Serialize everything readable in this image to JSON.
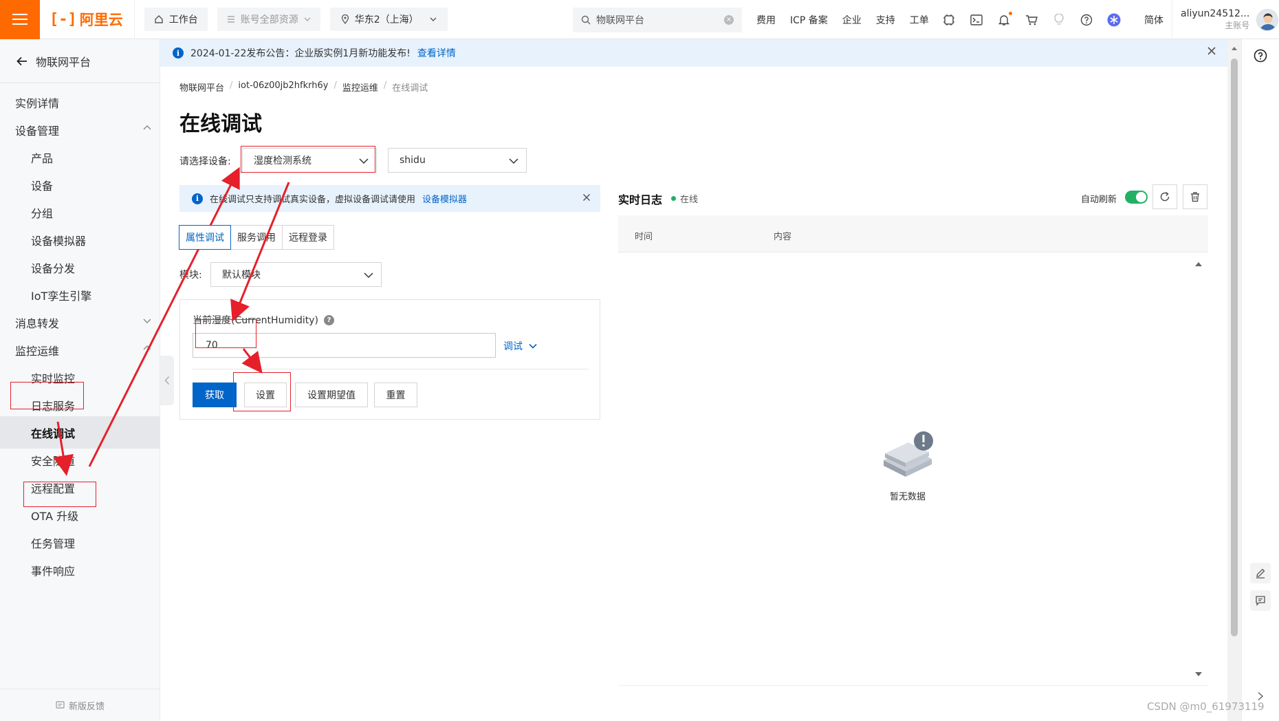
{
  "topbar": {
    "logo_text": "阿里云",
    "workbench": "工作台",
    "account_scope": "账号全部资源",
    "region": "华东2（上海）",
    "search_value": "物联网平台",
    "links": [
      "费用",
      "ICP 备案",
      "企业",
      "支持",
      "工单"
    ],
    "language": "简体",
    "account_name": "aliyun24512...",
    "account_role": "主账号"
  },
  "announcement": {
    "text": "2024-01-22发布公告：企业版实例1月新功能发布!",
    "link": "查看详情"
  },
  "sidebar": {
    "back_label": "物联网平台",
    "items": [
      {
        "label": "实例详情"
      },
      {
        "label": "设备管理"
      },
      {
        "label": "产品"
      },
      {
        "label": "设备"
      },
      {
        "label": "分组"
      },
      {
        "label": "设备模拟器"
      },
      {
        "label": "设备分发"
      },
      {
        "label": "IoT孪生引擎"
      },
      {
        "label": "消息转发"
      },
      {
        "label": "监控运维"
      },
      {
        "label": "实时监控"
      },
      {
        "label": "日志服务"
      },
      {
        "label": "在线调试"
      },
      {
        "label": "安全隧道"
      },
      {
        "label": "远程配置"
      },
      {
        "label": "OTA 升级"
      },
      {
        "label": "任务管理"
      },
      {
        "label": "事件响应"
      }
    ],
    "feedback": "新版反馈"
  },
  "breadcrumb": [
    "物联网平台",
    "iot-06z00jb2hfkrh6y",
    "监控运维",
    "在线调试"
  ],
  "page_title": "在线调试",
  "device_select": {
    "label": "请选择设备:",
    "product": "湿度检测系统",
    "device": "shidu"
  },
  "tip": {
    "text": "在线调试只支持调试真实设备，虚拟设备调试请使用",
    "link": "设备模拟器"
  },
  "tabs": [
    "属性调试",
    "服务调用",
    "远程登录"
  ],
  "module": {
    "label": "模块:",
    "value": "默认模块"
  },
  "property": {
    "label": "当前湿度(CurrentHumidity)",
    "value": "70",
    "debug_label": "调试"
  },
  "buttons": {
    "get": "获取",
    "set": "设置",
    "set_expected": "设置期望值",
    "reset": "重置"
  },
  "log": {
    "title": "实时日志",
    "status": "在线",
    "auto_refresh": "自动刷新",
    "col_time": "时间",
    "col_content": "内容",
    "empty": "暂无数据"
  },
  "watermark": "CSDN @m0_61973119",
  "colors": {
    "brand": "#ff6a00",
    "primary": "#0064c8",
    "success": "#23b066",
    "annotation": "#e5202a"
  }
}
